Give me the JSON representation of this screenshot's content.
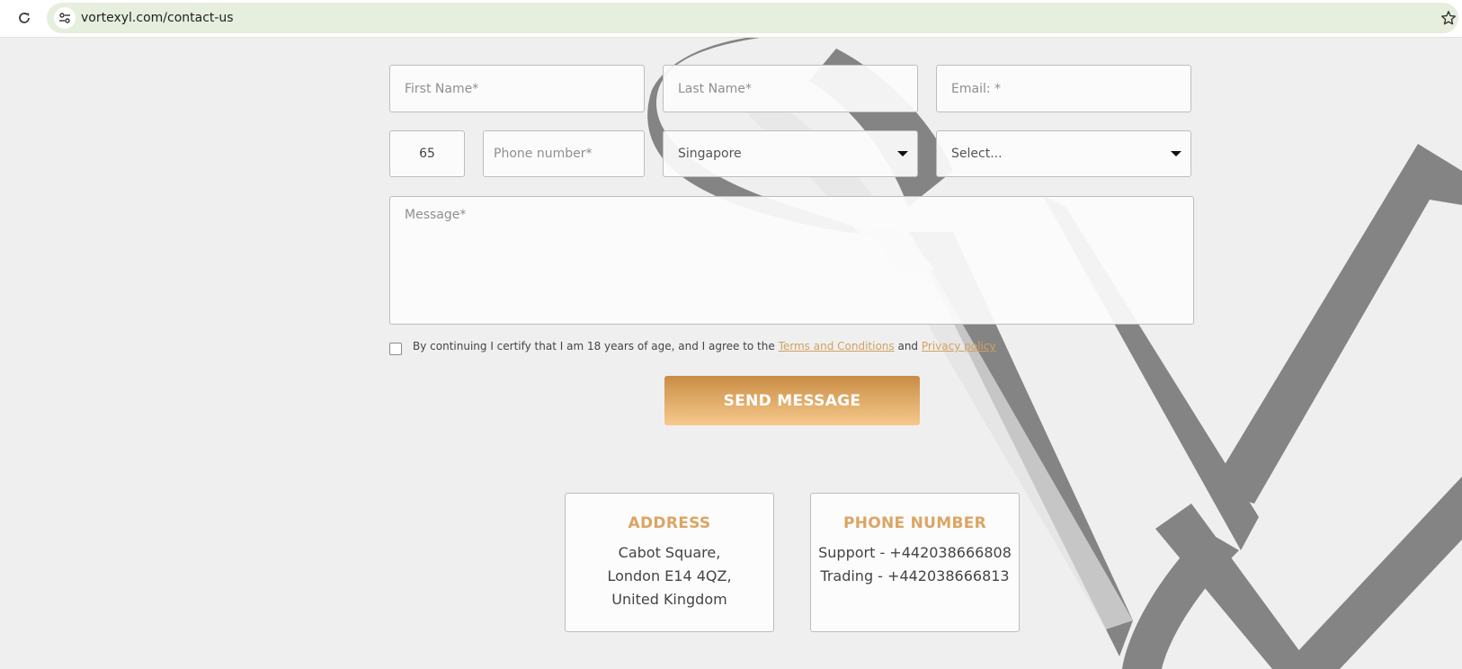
{
  "browser": {
    "url": "vortexyl.com/contact-us"
  },
  "form": {
    "first_name_placeholder": "First Name*",
    "last_name_placeholder": "Last Name*",
    "email_placeholder": "Email: *",
    "country_code": "65",
    "phone_placeholder": "Phone number*",
    "country": "Singapore",
    "select_placeholder": "Select...",
    "message_placeholder": "Message*",
    "consent": {
      "text_before": "By continuing I certify that I am 18 years of age, and I agree to the",
      "terms_link": "Terms and Conditions",
      "and": "and",
      "privacy_link": "Privacy policy"
    },
    "submit_label": "SEND MESSAGE"
  },
  "cards": {
    "address": {
      "title": "ADDRESS",
      "lines": [
        "Cabot Square,",
        "London E14 4QZ,",
        "United Kingdom"
      ]
    },
    "phone": {
      "title": "PHONE NUMBER",
      "lines": [
        "Support - +442038666808",
        "Trading - +442038666813"
      ]
    }
  },
  "colors": {
    "accent": "#dba564",
    "button_top": "#c98d44",
    "button_bottom": "#f6c98c",
    "link": "#d2a160",
    "logo_dark": "#848484",
    "logo_light": "#e6e6e6"
  },
  "icons": {
    "reload": "reload-icon",
    "site_settings": "tune-icon",
    "bookmark": "star-icon",
    "select_caret": "caret-down-icon"
  }
}
